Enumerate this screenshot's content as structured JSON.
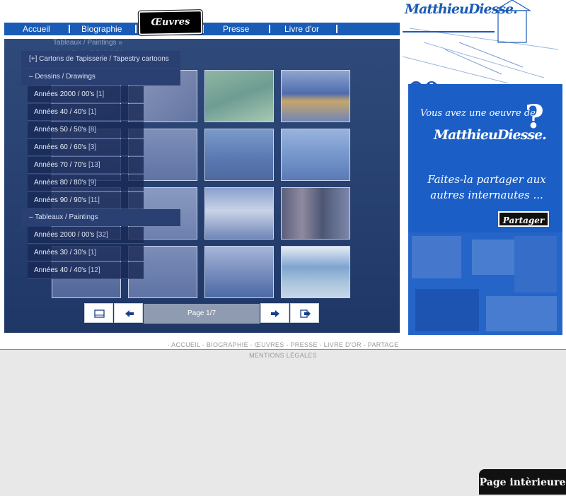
{
  "nav": {
    "items": [
      "Accueil",
      "Biographie",
      "Œuvres",
      "Presse",
      "Livre d'or"
    ],
    "active": "Œuvres"
  },
  "breadcrumb": "Tableaux / Paintings »",
  "ghost_title": "Années 90 / 90's",
  "menu": {
    "tapestry": "[+]  Cartons de Tapisserie /  Tapestry cartoons",
    "drawings_head": "– Dessins / Drawings",
    "drawings": [
      {
        "label": "Années 2000 / 00's",
        "count": "[1]"
      },
      {
        "label": "Années 40 / 40's",
        "count": "[1]"
      },
      {
        "label": "Années  50 / 50's",
        "count": "[8]"
      },
      {
        "label": "Années 60 / 60's",
        "count": "[3]"
      },
      {
        "label": "Années 70 / 70's",
        "count": "[13]"
      },
      {
        "label": "Années 80 / 80's",
        "count": "[9]"
      },
      {
        "label": "Années 90 / 90's",
        "count": "[11]"
      }
    ],
    "paintings_head": "– Tableaux / Paintings",
    "paintings": [
      {
        "label": "Années 2000 / 00's",
        "count": "[32]"
      },
      {
        "label": "Années 30 / 30's",
        "count": "[1]"
      },
      {
        "label": "Années 40 / 40's",
        "count": "[12]"
      }
    ]
  },
  "pager": {
    "label": "Page 1/7"
  },
  "logo": "MatthieuDiesse.",
  "ad": {
    "line1": "Vous avez une oeuvre de",
    "logo": "MatthieuDiesse.",
    "question": "?",
    "line2": "Faites-la partager aux autres internautes ...",
    "button": "Partager"
  },
  "footer": {
    "links": "- ACCUEIL - BIOGRAPHIE - ŒUVRES - PRESSE - LIVRE D'OR - PARTAGE",
    "legal": "MENTIONS LÉGALES"
  },
  "corner_tab": "Page intèrieure",
  "colors": {
    "brand_blue": "#1a5bb5",
    "panel": "#2a4272"
  }
}
